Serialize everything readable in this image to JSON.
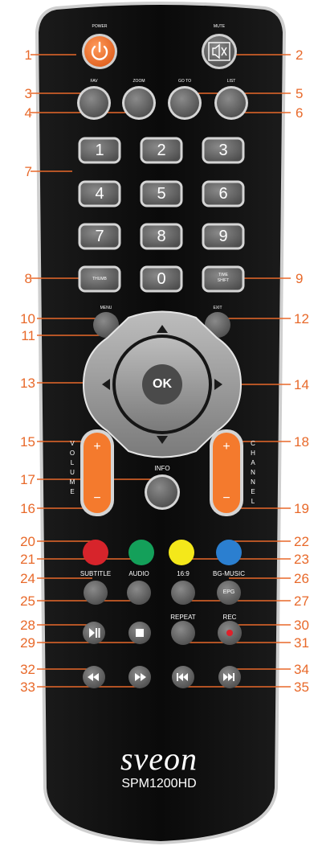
{
  "colors": {
    "accent": "#e8692a",
    "body": "#0d0d0d",
    "button_grey": "#6b6b6b",
    "red": "#d7242b",
    "green": "#14a05a",
    "yellow": "#f4e81a",
    "blue": "#2b7fd0"
  },
  "callouts": {
    "n1": "1",
    "n2": "2",
    "n3": "3",
    "n4": "4",
    "n5": "5",
    "n6": "6",
    "n7": "7",
    "n8": "8",
    "n9": "9",
    "n10": "10",
    "n11": "11",
    "n12": "12",
    "n13": "13",
    "n14": "14",
    "n15": "15",
    "n16": "16",
    "n17": "17",
    "n18": "18",
    "n19": "19",
    "n20": "20",
    "n21": "21",
    "n22": "22",
    "n23": "23",
    "n24": "24",
    "n25": "25",
    "n26": "26",
    "n27": "27",
    "n28": "28",
    "n29": "29",
    "n30": "30",
    "n31": "31",
    "n32": "32",
    "n33": "33",
    "n34": "34",
    "n35": "35"
  },
  "labels": {
    "power": "POWER",
    "mute": "MUTE",
    "fav": "FAV",
    "zoom": "ZOOM",
    "goto": "GO TO",
    "list": "LIST",
    "thumb": "THUMB",
    "timeshift_1": "TIME",
    "timeshift_2": "SHIFT",
    "menu": "MENU",
    "exit": "EXIT",
    "ok": "OK",
    "info": "INFO",
    "volume": [
      "V",
      "O",
      "L",
      "U",
      "M",
      "E"
    ],
    "channel": [
      "C",
      "H",
      "A",
      "N",
      "N",
      "E",
      "L"
    ],
    "plus": "+",
    "minus": "−",
    "subtitle": "SUBTITLE",
    "audio": "AUDIO",
    "aspect": "16:9",
    "bgmusic": "BG-MUSIC",
    "epg": "EPG",
    "repeat": "REPEAT",
    "rec": "REC"
  },
  "digits": [
    "1",
    "2",
    "3",
    "4",
    "5",
    "6",
    "7",
    "8",
    "9",
    "0"
  ],
  "brand": {
    "logo": "sveon",
    "model": "SPM1200HD"
  },
  "icons": {
    "power": "power-icon",
    "mute": "speaker-mute-icon",
    "play_pause": "play-pause-icon",
    "stop": "stop-icon",
    "rec": "record-icon",
    "rewind": "rewind-icon",
    "fast_forward": "fast-forward-icon",
    "prev": "skip-previous-icon",
    "next": "skip-next-icon",
    "up": "arrow-up-icon",
    "down": "arrow-down-icon",
    "left": "arrow-left-icon",
    "right": "arrow-right-icon"
  }
}
